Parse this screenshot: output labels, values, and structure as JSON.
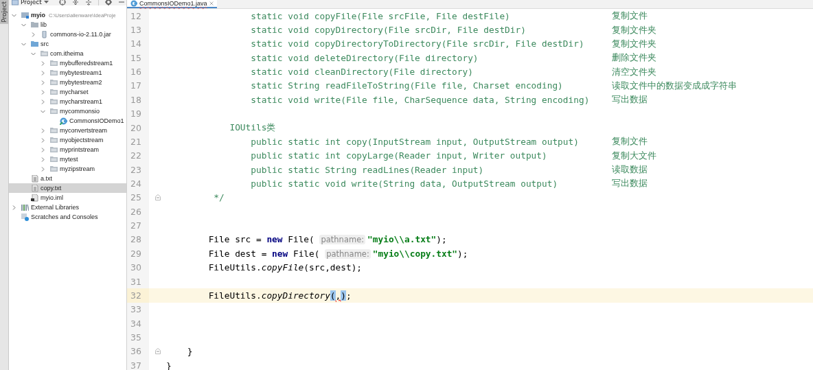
{
  "side_strip": {
    "label": "Project"
  },
  "project_panel": {
    "title": "Project",
    "toolbar": [
      {
        "kind": "target"
      },
      {
        "kind": "expand"
      },
      {
        "kind": "collapse"
      },
      {
        "kind": "gear"
      },
      {
        "kind": "hide"
      }
    ],
    "tree": [
      {
        "name": "myio",
        "path": "C:\\Users\\alienware\\IdeaProje",
        "kind": "module",
        "expanded": true,
        "selected": false,
        "children": [
          {
            "name": "lib",
            "kind": "folder",
            "expanded": true,
            "selected": false,
            "children": [
              {
                "name": "commons-io-2.11.0.jar",
                "kind": "jar",
                "expanded": false,
                "selected": false
              }
            ]
          },
          {
            "name": "src",
            "kind": "source",
            "expanded": true,
            "selected": false,
            "children": [
              {
                "name": "com.itheima",
                "kind": "package",
                "expanded": true,
                "selected": false,
                "children": [
                  {
                    "name": "mybufferedstream1",
                    "kind": "package",
                    "expanded": false,
                    "selected": false
                  },
                  {
                    "name": "mybytestream1",
                    "kind": "package",
                    "expanded": false,
                    "selected": false
                  },
                  {
                    "name": "mybytestream2",
                    "kind": "package",
                    "expanded": false,
                    "selected": false
                  },
                  {
                    "name": "mycharset",
                    "kind": "package",
                    "expanded": false,
                    "selected": false
                  },
                  {
                    "name": "mycharstream1",
                    "kind": "package",
                    "expanded": false,
                    "selected": false
                  },
                  {
                    "name": "mycommonsio",
                    "kind": "package",
                    "expanded": true,
                    "selected": false,
                    "children": [
                      {
                        "name": "CommonsIODemo1",
                        "kind": "class",
                        "selected": false
                      }
                    ]
                  },
                  {
                    "name": "myconvertstream",
                    "kind": "package",
                    "expanded": false,
                    "selected": false
                  },
                  {
                    "name": "myobjectstream",
                    "kind": "package",
                    "expanded": false,
                    "selected": false
                  },
                  {
                    "name": "myprintstream",
                    "kind": "package",
                    "expanded": false,
                    "selected": false
                  },
                  {
                    "name": "mytest",
                    "kind": "package",
                    "expanded": false,
                    "selected": false
                  },
                  {
                    "name": "myzipstream",
                    "kind": "package",
                    "expanded": false,
                    "selected": false
                  }
                ]
              }
            ]
          },
          {
            "name": "a.txt",
            "kind": "text",
            "selected": false
          },
          {
            "name": "copy.txt",
            "kind": "text",
            "selected": true
          },
          {
            "name": "myio.iml",
            "kind": "iml",
            "selected": false
          }
        ]
      },
      {
        "name": "External Libraries",
        "kind": "libraries",
        "expanded": false,
        "selected": false
      },
      {
        "name": "Scratches and Consoles",
        "kind": "scratches",
        "selected": false
      }
    ]
  },
  "editor": {
    "tabs": [
      {
        "label": "CommonsIODemo1.java",
        "selected": true
      }
    ],
    "lines": [
      {
        "number": "12",
        "current": false,
        "fold": false,
        "tokens": [
          {
            "kind": "comment",
            "text": "                static void copyFile(File srcFile, File destFile)"
          }
        ],
        "note": "复制文件"
      },
      {
        "number": "13",
        "current": false,
        "fold": false,
        "tokens": [
          {
            "kind": "comment",
            "text": "                static void copyDirectory(File srcDir, File destDir)"
          }
        ],
        "note": "复制文件夹"
      },
      {
        "number": "14",
        "current": false,
        "fold": false,
        "tokens": [
          {
            "kind": "comment",
            "text": "                static void copyDirectoryToDirectory(File srcDir, File destDir)"
          }
        ],
        "note": "复制文件夹"
      },
      {
        "number": "15",
        "current": false,
        "fold": false,
        "tokens": [
          {
            "kind": "comment",
            "text": "                static void deleteDirectory(File directory)"
          }
        ],
        "note": "删除文件夹"
      },
      {
        "number": "16",
        "current": false,
        "fold": false,
        "tokens": [
          {
            "kind": "comment",
            "text": "                static void cleanDirectory(File directory)"
          }
        ],
        "note": "清空文件夹"
      },
      {
        "number": "17",
        "current": false,
        "fold": false,
        "tokens": [
          {
            "kind": "comment",
            "text": "                static String readFileToString(File file, Charset encoding)"
          }
        ],
        "note": "读取文件中的数据变成成字符串"
      },
      {
        "number": "18",
        "current": false,
        "fold": false,
        "tokens": [
          {
            "kind": "comment",
            "text": "                static void write(File file, CharSequence data, String encoding)"
          }
        ],
        "note": "写出数据"
      },
      {
        "number": "19",
        "current": false,
        "fold": false
      },
      {
        "number": "20",
        "current": false,
        "fold": false,
        "tokens": [
          {
            "kind": "comment",
            "text": "            IOUtils类"
          }
        ]
      },
      {
        "number": "21",
        "current": false,
        "fold": false,
        "tokens": [
          {
            "kind": "comment",
            "text": "                public static int copy(InputStream input, OutputStream output)"
          }
        ],
        "note": "复制文件"
      },
      {
        "number": "22",
        "current": false,
        "fold": false,
        "tokens": [
          {
            "kind": "comment",
            "text": "                public static int copyLarge(Reader input, Writer output)"
          }
        ],
        "note": "复制大文件"
      },
      {
        "number": "23",
        "current": false,
        "fold": false,
        "tokens": [
          {
            "kind": "comment",
            "text": "                public static String readLines(Reader input)"
          }
        ],
        "note": "读取数据"
      },
      {
        "number": "24",
        "current": false,
        "fold": false,
        "tokens": [
          {
            "kind": "comment",
            "text": "                public static void write(String data, OutputStream output)"
          }
        ],
        "note": "写出数据"
      },
      {
        "number": "25",
        "current": false,
        "fold": true,
        "tokens": [
          {
            "kind": "comment",
            "text": "         */"
          }
        ]
      },
      {
        "number": "26",
        "current": false,
        "fold": false
      },
      {
        "number": "27",
        "current": false,
        "fold": false
      },
      {
        "number": "28",
        "current": false,
        "fold": false,
        "tokens": [
          {
            "kind": "plain",
            "text": "        File src = "
          },
          {
            "kind": "keyword",
            "text": "new"
          },
          {
            "kind": "plain",
            "text": " File( "
          },
          {
            "kind": "hint",
            "text": "pathname:"
          },
          {
            "kind": "string",
            "text": "\"myio\\\\a.txt\""
          },
          {
            "kind": "plain",
            "text": ");"
          }
        ]
      },
      {
        "number": "29",
        "current": false,
        "fold": false,
        "tokens": [
          {
            "kind": "plain",
            "text": "        File dest = "
          },
          {
            "kind": "keyword",
            "text": "new"
          },
          {
            "kind": "plain",
            "text": " File( "
          },
          {
            "kind": "hint",
            "text": "pathname:"
          },
          {
            "kind": "string",
            "text": "\"myio\\\\copy.txt\""
          },
          {
            "kind": "plain",
            "text": ");"
          }
        ]
      },
      {
        "number": "30",
        "current": false,
        "fold": false,
        "tokens": [
          {
            "kind": "plain",
            "text": "        FileUtils."
          },
          {
            "kind": "static",
            "text": "copyFile"
          },
          {
            "kind": "plain",
            "text": "(src,dest);"
          }
        ]
      },
      {
        "number": "31",
        "current": false,
        "fold": false
      },
      {
        "number": "32",
        "current": true,
        "fold": false,
        "tokens": [
          {
            "kind": "plain",
            "text": "        FileUtils."
          },
          {
            "kind": "static",
            "text": "copyDirectory"
          },
          {
            "kind": "match",
            "text": "("
          },
          {
            "kind": "error",
            "text": ","
          },
          {
            "kind": "match",
            "text": ")"
          },
          {
            "kind": "plain",
            "text": ";"
          }
        ]
      },
      {
        "number": "33",
        "current": false,
        "fold": false
      },
      {
        "number": "34",
        "current": false,
        "fold": false
      },
      {
        "number": "35",
        "current": false,
        "fold": false
      },
      {
        "number": "36",
        "current": false,
        "fold": true,
        "tokens": [
          {
            "kind": "plain",
            "text": "    }"
          }
        ]
      },
      {
        "number": "37",
        "current": false,
        "fold": false,
        "tokens": [
          {
            "kind": "plain",
            "text": "}"
          }
        ]
      }
    ]
  }
}
